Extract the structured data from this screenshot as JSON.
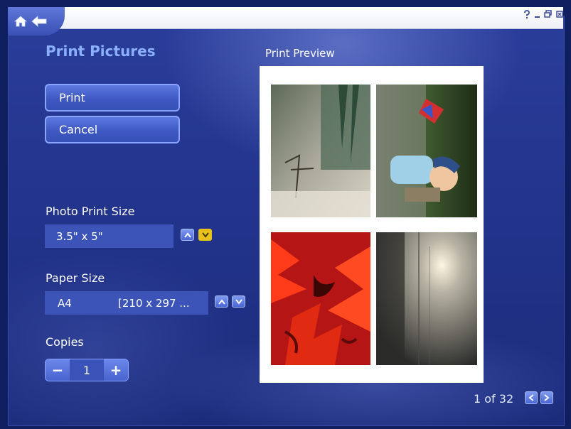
{
  "header": {
    "help_icon": "help-icon",
    "minimize_icon": "minimize-icon",
    "restore_icon": "restore-icon",
    "close_icon": "close-icon"
  },
  "page": {
    "title": "Print Pictures"
  },
  "actions": {
    "print_label": "Print",
    "cancel_label": "Cancel"
  },
  "photo_print_size": {
    "label": "Photo Print Size",
    "value": "3.5\" x 5\""
  },
  "paper_size": {
    "label": "Paper Size",
    "name": "A4",
    "dimensions": "[210 x 297 ..."
  },
  "copies": {
    "label": "Copies",
    "value": "1",
    "decrement": "−",
    "increment": "+"
  },
  "preview": {
    "label": "Print Preview",
    "photos": [
      {
        "name": "photo-plant-rock"
      },
      {
        "name": "photo-child-with-pinwheel"
      },
      {
        "name": "photo-red-flower"
      },
      {
        "name": "photo-sunset-sea"
      }
    ]
  },
  "pager": {
    "text": "1 of 32"
  },
  "colors": {
    "accent": "#8ab0ff",
    "arrow_highlight": "#e7c21a",
    "background": "#22348c"
  }
}
